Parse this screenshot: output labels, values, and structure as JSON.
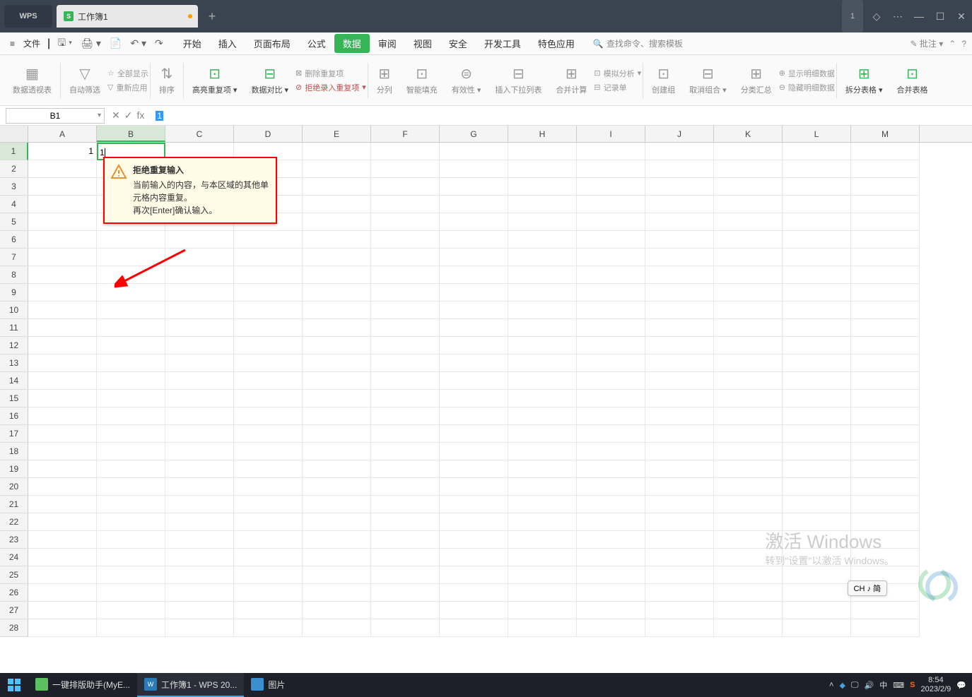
{
  "titlebar": {
    "logo": "WPS",
    "doc_icon": "S",
    "doc_name": "工作簿1",
    "badge": "1"
  },
  "menu": {
    "file": "文件",
    "tabs": [
      "开始",
      "插入",
      "页面布局",
      "公式",
      "数据",
      "审阅",
      "视图",
      "安全",
      "开发工具",
      "特色应用"
    ],
    "active_tab": "数据",
    "search_placeholder": "查找命令、搜索模板",
    "right_label": "批注",
    "help": "?"
  },
  "ribbon": {
    "g1": "数据透视表",
    "g2": "自动筛选",
    "g2a": "全部显示",
    "g2b": "重新应用",
    "g3": "排序",
    "g4": "高亮重复项",
    "g5": "数据对比",
    "g5a": "删除重复项",
    "g5b": "拒绝录入重复项",
    "g6": "分列",
    "g7": "智能填充",
    "g8": "有效性",
    "g9": "插入下拉列表",
    "g10": "合并计算",
    "g10a": "模拟分析",
    "g10b": "记录单",
    "g11": "创建组",
    "g12": "取消组合",
    "g13": "分类汇总",
    "g13a": "显示明细数据",
    "g13b": "隐藏明细数据",
    "g14": "拆分表格",
    "g15": "合并表格"
  },
  "formula": {
    "cell_ref": "B1",
    "fx": "fx",
    "value": "1"
  },
  "grid": {
    "columns": [
      "A",
      "B",
      "C",
      "D",
      "E",
      "F",
      "G",
      "H",
      "I",
      "J",
      "K",
      "L",
      "M"
    ],
    "rows": 28,
    "a1_value": "1",
    "b1_value": "1"
  },
  "tooltip": {
    "title": "拒绝重复输入",
    "line1": "当前输入的内容，与本区域的其他单元格内容重复。",
    "line2": "再次[Enter]确认输入。"
  },
  "watermark": {
    "title": "激活 Windows",
    "sub": "转到\"设置\"以激活 Windows。"
  },
  "ime": "CH ♪ 简",
  "taskbar": {
    "items": [
      {
        "label": "一键排版助手(MyE...",
        "bg": "#5cc060"
      },
      {
        "label": "工作簿1 - WPS 20...",
        "bg": "#2a7bb8"
      },
      {
        "label": "图片",
        "bg": "#3a8fd0"
      }
    ],
    "tray_lang": "中",
    "time": "8:54",
    "date": "2023/2/9"
  }
}
